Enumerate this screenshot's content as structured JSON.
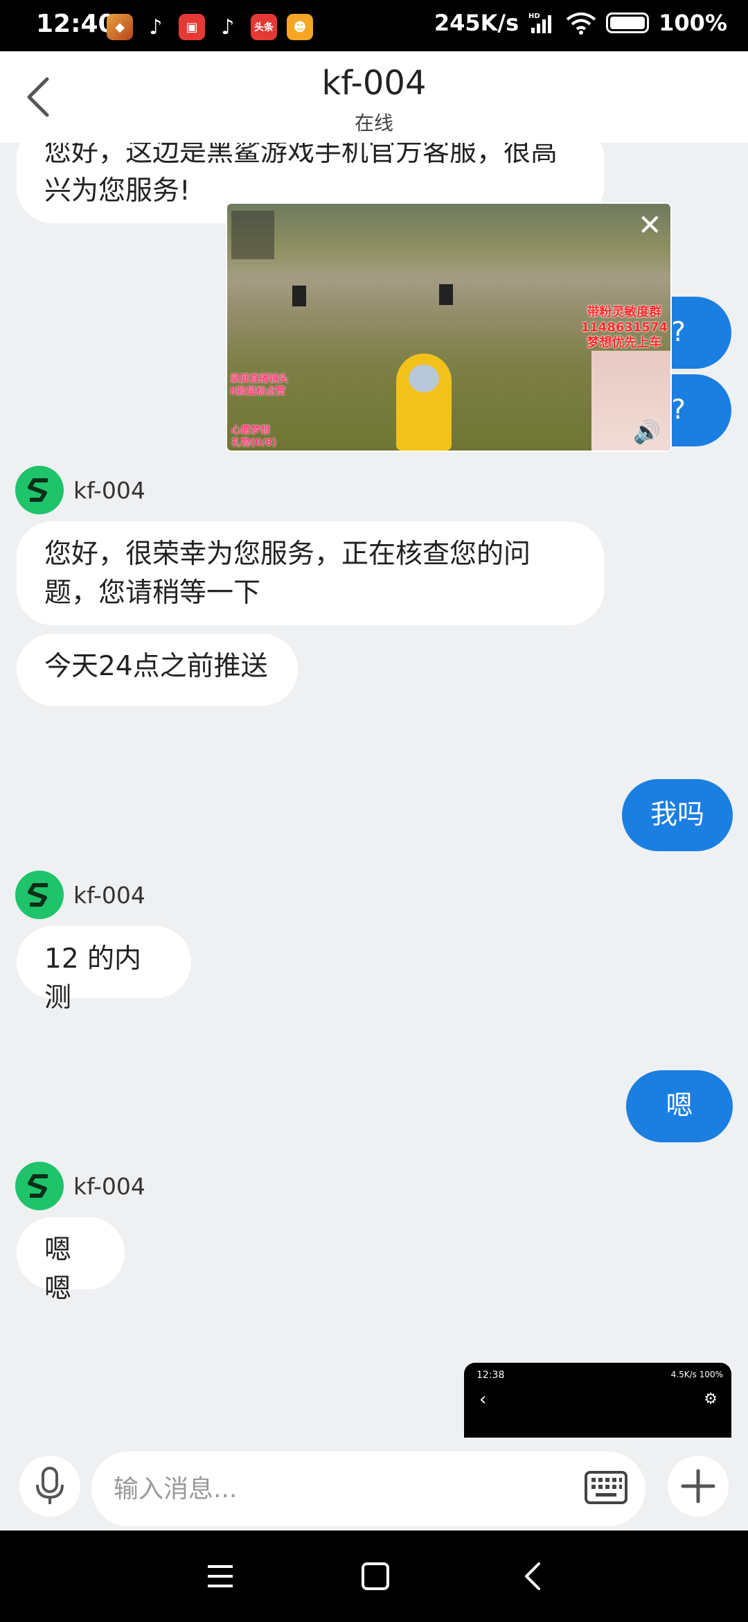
{
  "status_bar": {
    "time": "12:40",
    "net_speed": "245K/s",
    "network": "HD",
    "battery": "100%"
  },
  "header": {
    "title": "kf-004",
    "status": "在线"
  },
  "chat": {
    "agent_name": "kf-004",
    "msg_top": "您好，这边是黑鲨游戏手机官方客服，很高兴为您服务!",
    "hidden_me_1": "?",
    "hidden_me_2": "?",
    "msg_agent_1": "您好，很荣幸为您服务，正在核查您的问题，您请稍等一下",
    "msg_agent_2": "今天24点之前推送",
    "msg_me_1": "我吗",
    "msg_agent_3": "12 的内测",
    "msg_me_2": "嗯",
    "msg_agent_4": "嗯嗯"
  },
  "video": {
    "overlay_red": [
      "带粉灵敏度群",
      "1148631574",
      "梦想优先上车"
    ],
    "overlay_pink": [
      "录屏直播镜头",
      "8款鼠标点赞"
    ],
    "overlay_dream": [
      "心愿梦想",
      "礼物(0/8)"
    ],
    "close_icon": "close-icon",
    "volume_icon": "volume-icon"
  },
  "mini_preview": {
    "time": "12:38",
    "status": "4.5K/s 100%"
  },
  "input": {
    "placeholder": "输入消息..."
  },
  "nav_icons": [
    "menu-icon",
    "home-icon",
    "back-icon"
  ]
}
